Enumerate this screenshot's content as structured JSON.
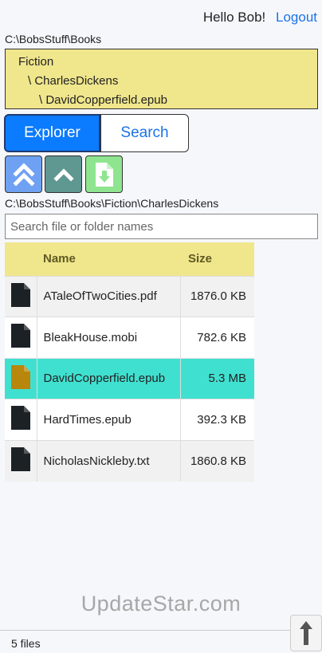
{
  "header": {
    "greeting": "Hello Bob!",
    "logout_label": "Logout"
  },
  "tree": {
    "root_path": "C:\\BobsStuff\\Books",
    "nodes": [
      "Fiction",
      "\\ CharlesDickens",
      "\\ DavidCopperfield.epub"
    ]
  },
  "tabs": [
    {
      "label": "Explorer",
      "active": true
    },
    {
      "label": "Search",
      "active": false
    }
  ],
  "toolbar": {
    "root_icon": "double-chevron-up-icon",
    "up_icon": "chevron-up-icon",
    "download_icon": "file-download-icon"
  },
  "current_path": "C:\\BobsStuff\\Books\\Fiction\\CharlesDickens",
  "search": {
    "placeholder": "Search file or folder names",
    "value": ""
  },
  "table": {
    "headers": {
      "name": "Name",
      "size": "Size"
    },
    "rows": [
      {
        "name": "ATaleOfTwoCities.pdf",
        "size": "1876.0 KB",
        "selected": false
      },
      {
        "name": "BleakHouse.mobi",
        "size": "782.6 KB",
        "selected": false
      },
      {
        "name": "DavidCopperfield.epub",
        "size": "5.3 MB",
        "selected": true
      },
      {
        "name": "HardTimes.epub",
        "size": "392.3 KB",
        "selected": false
      },
      {
        "name": "NicholasNickleby.txt",
        "size": "1860.8 KB",
        "selected": false
      }
    ]
  },
  "colors": {
    "accent": "#0b7bff",
    "tree_bg": "#f0e68c",
    "selected_row": "#40e0d0",
    "file_icon": "#1c2126",
    "selected_file_icon": "#b8860b"
  },
  "watermark": "UpdateStar.com",
  "status": {
    "file_count": "5 files"
  }
}
